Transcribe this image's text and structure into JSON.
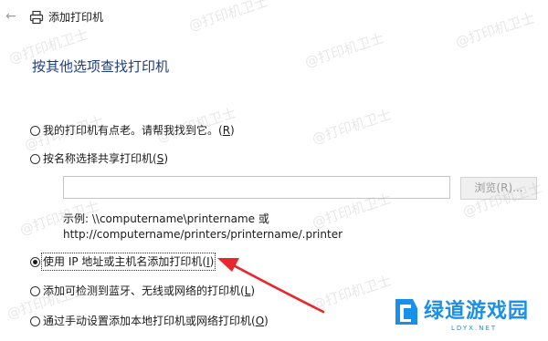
{
  "window": {
    "title": "添加打印机"
  },
  "heading": "按其他选项查找打印机",
  "options": [
    {
      "label": "我的打印机有点老。请帮我找到它。",
      "shortcut": "R",
      "checked": false
    },
    {
      "label": "按名称选择共享打印机",
      "shortcut": "S",
      "checked": false
    },
    {
      "label": "使用 IP 地址或主机名添加打印机",
      "shortcut": "I",
      "checked": true
    },
    {
      "label": "添加可检测到蓝牙、无线或网络的打印机",
      "shortcut": "L",
      "checked": false
    },
    {
      "label": "通过手动设置添加本地打印机或网络打印机",
      "shortcut": "O",
      "checked": false
    }
  ],
  "shared_printer": {
    "value": "",
    "browse_label": "浏览(R)...",
    "example_line1": "示例: \\\\computername\\printername 或",
    "example_line2": "http://computername/printers/printername/.printer"
  },
  "watermark": "@打印机卫士",
  "brand": {
    "name": "绿道游戏园",
    "sub": "LDYX.NET"
  },
  "colors": {
    "heading": "#1f3d82",
    "annotation_arrow": "#e8262b",
    "brand": "#1890e8"
  }
}
